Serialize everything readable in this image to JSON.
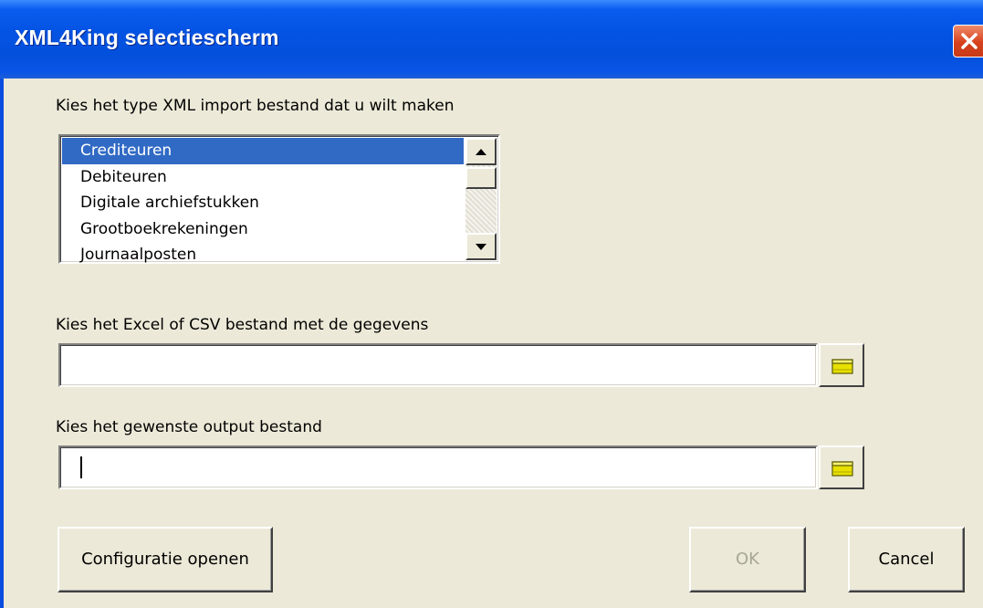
{
  "window": {
    "title": "XML4King selectiescherm"
  },
  "type_section": {
    "label": "Kies het type XML import bestand dat u wilt maken",
    "items": [
      "Crediteuren",
      "Debiteuren",
      "Digitale archiefstukken",
      "Grootboekrekeningen",
      "Journaalposten"
    ],
    "selected": "Crediteuren"
  },
  "input_section": {
    "label": "Kies het Excel of CSV bestand met de gegevens",
    "value": ""
  },
  "output_section": {
    "label": "Kies het gewenste output bestand",
    "value": ""
  },
  "buttons": {
    "config": "Configuratie openen",
    "ok": "OK",
    "cancel": "Cancel"
  },
  "colors": {
    "titlebar": "#0453e3",
    "selection": "#316ac5",
    "dialog_bg": "#ece9d8",
    "close": "#d6411c"
  }
}
